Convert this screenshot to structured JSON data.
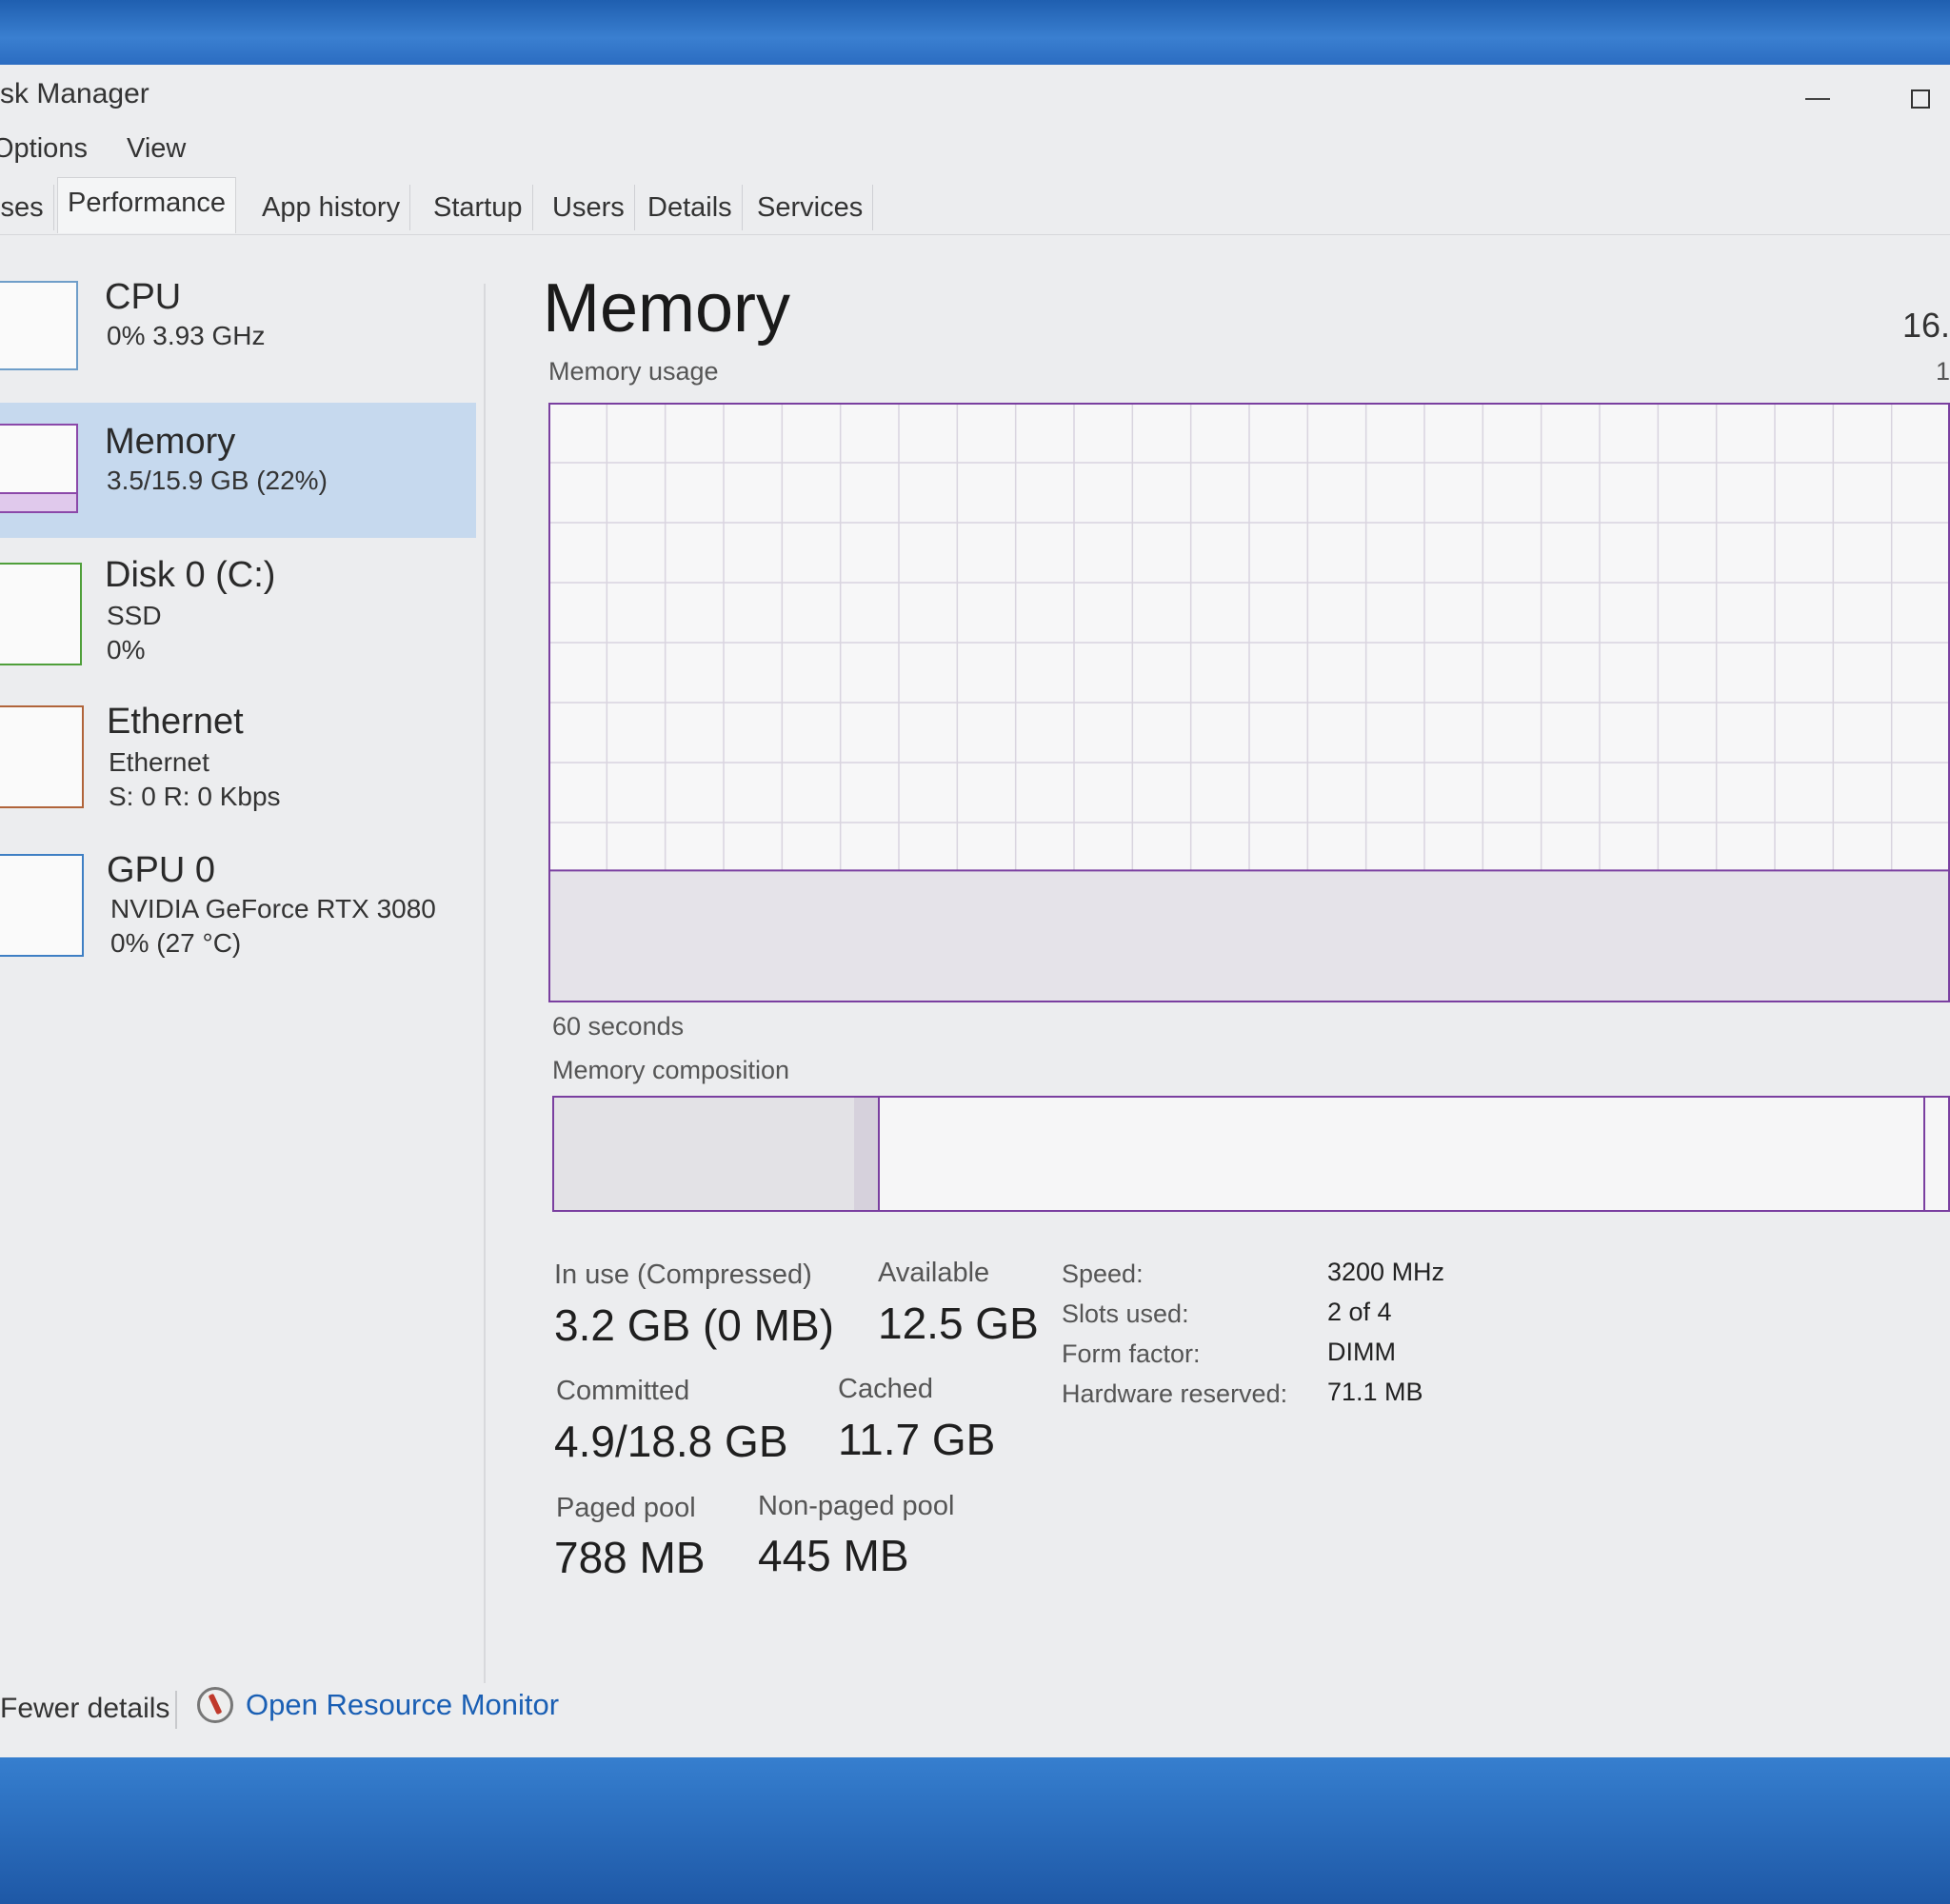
{
  "window": {
    "title": "sk Manager"
  },
  "menu": {
    "options": "Options",
    "view": "View"
  },
  "tabs": [
    {
      "label": "sses"
    },
    {
      "label": "Performance"
    },
    {
      "label": "App history"
    },
    {
      "label": "Startup"
    },
    {
      "label": "Users"
    },
    {
      "label": "Details"
    },
    {
      "label": "Services"
    }
  ],
  "sidebar": {
    "items": [
      {
        "title": "CPU",
        "line1": "0%  3.93 GHz",
        "line2": ""
      },
      {
        "title": "Memory",
        "line1": "3.5/15.9 GB (22%)",
        "line2": ""
      },
      {
        "title": "Disk 0 (C:)",
        "line1": "SSD",
        "line2": "0%"
      },
      {
        "title": "Ethernet",
        "line1": "Ethernet",
        "line2": "S: 0  R: 0 Kbps"
      },
      {
        "title": "GPU 0",
        "line1": "NVIDIA GeForce RTX 3080",
        "line2": "0%  (27 °C)"
      }
    ],
    "selected_index": 1
  },
  "main": {
    "title": "Memory",
    "total": "16.",
    "usage_label": "Memory usage",
    "usage_max": "1",
    "seconds_label": "60 seconds",
    "composition_label": "Memory composition",
    "usage_fraction": 0.22,
    "composition": {
      "in_use_fraction": 0.215,
      "modified_fraction": 0.017,
      "standby_fraction": 0.75
    }
  },
  "stats": {
    "in_use_label": "In use (Compressed)",
    "in_use_value": "3.2 GB (0 MB)",
    "available_label": "Available",
    "available_value": "12.5 GB",
    "committed_label": "Committed",
    "committed_value": "4.9/18.8 GB",
    "cached_label": "Cached",
    "cached_value": "11.7 GB",
    "paged_label": "Paged pool",
    "paged_value": "788 MB",
    "nonpaged_label": "Non-paged pool",
    "nonpaged_value": "445 MB"
  },
  "hardware": [
    {
      "label": "Speed:",
      "value": "3200 MHz"
    },
    {
      "label": "Slots used:",
      "value": "2 of 4"
    },
    {
      "label": "Form factor:",
      "value": "DIMM"
    },
    {
      "label": "Hardware reserved:",
      "value": "71.1 MB"
    }
  ],
  "footer": {
    "fewer_details": "Fewer details",
    "open_resource_monitor": "Open Resource Monitor"
  },
  "colors": {
    "memory_accent": "#7a3fa0",
    "selected_bg": "#c6d9ee",
    "link": "#1a5fb4"
  }
}
